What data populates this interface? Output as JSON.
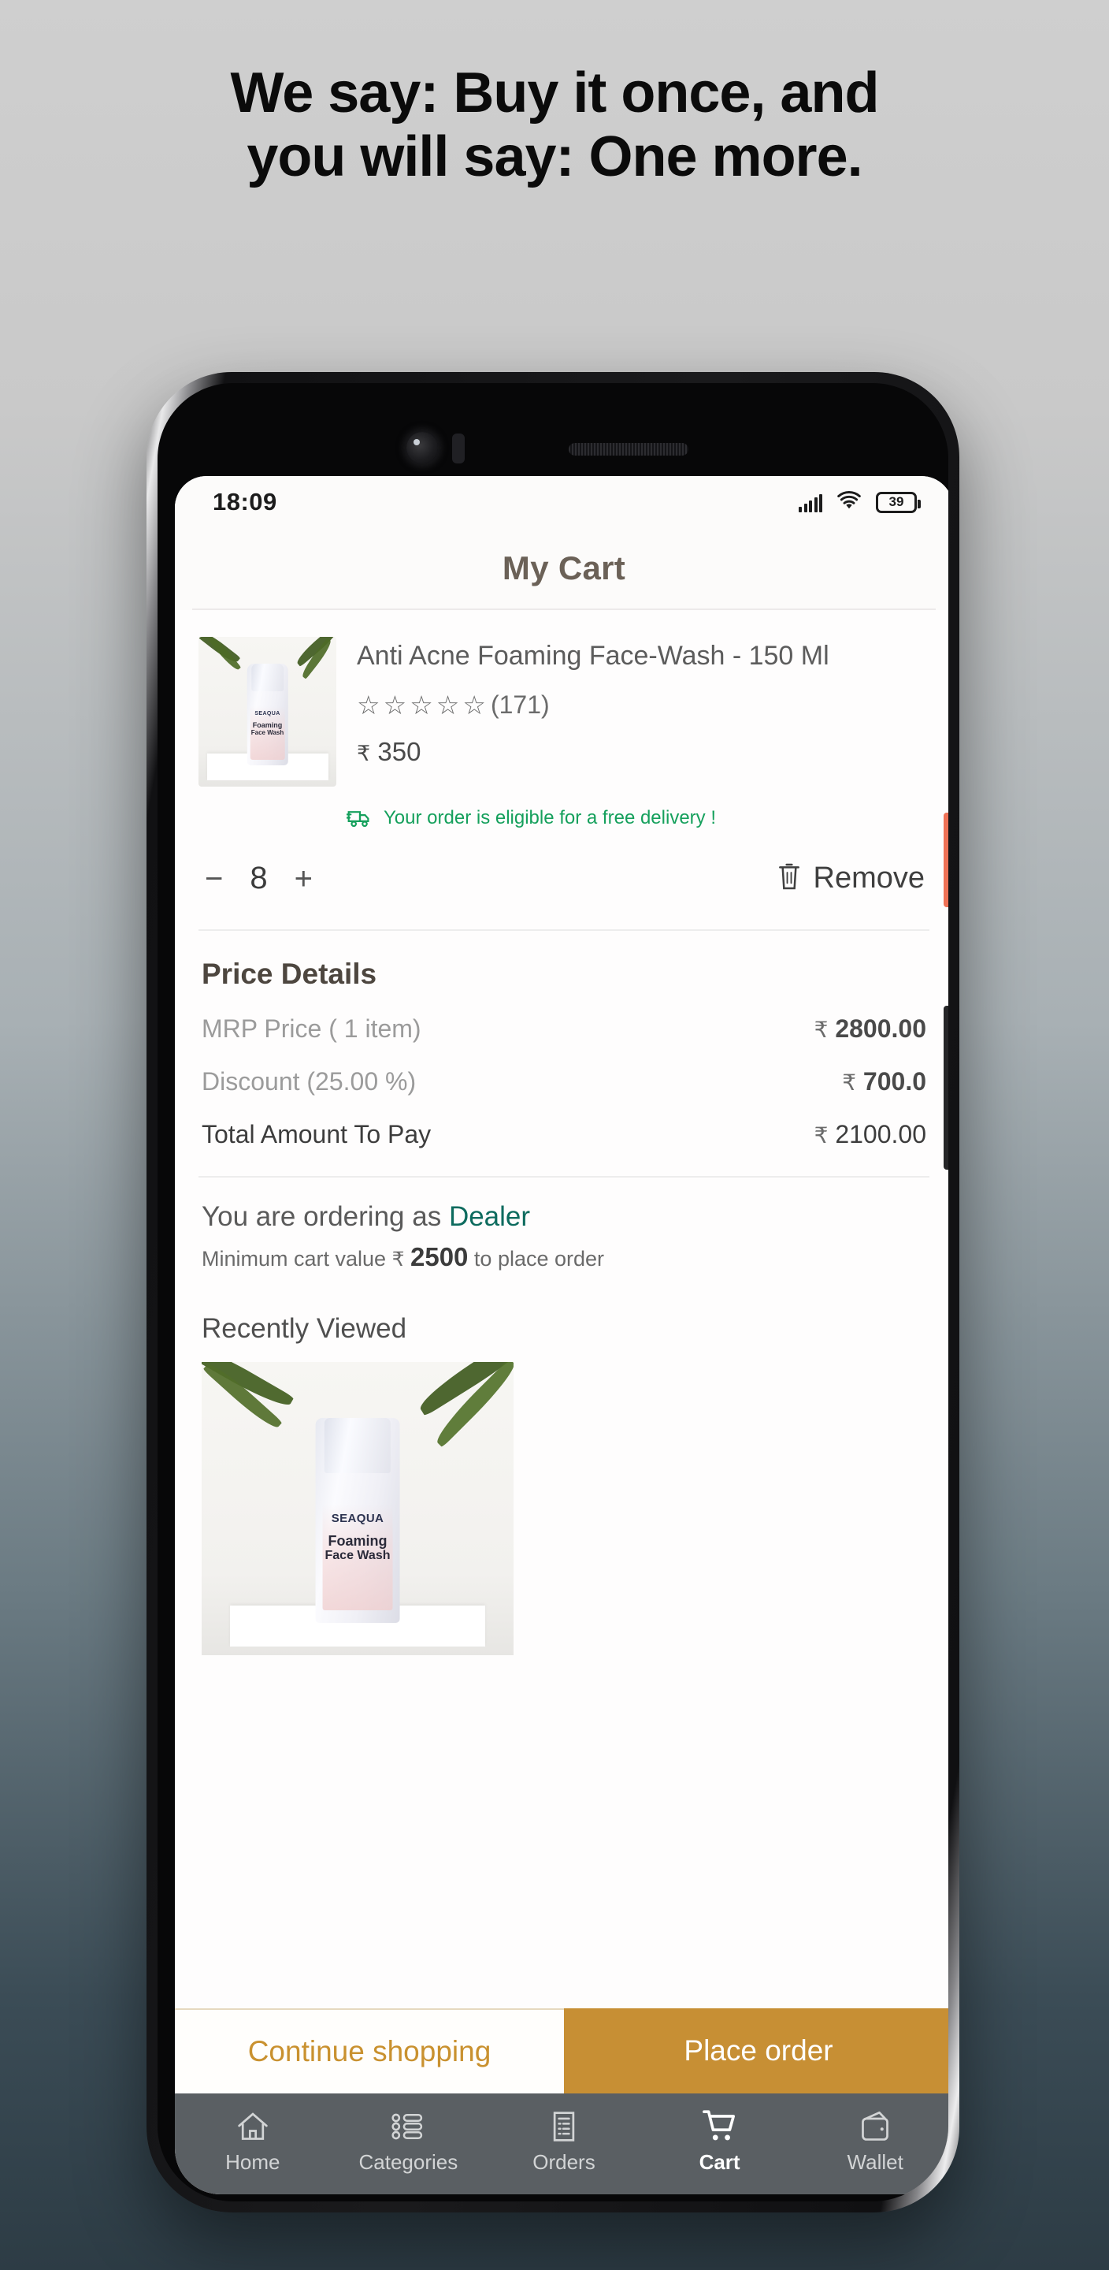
{
  "promo": {
    "line1": "We say: Buy it once, and",
    "line2": "you will say: One more."
  },
  "statusbar": {
    "time": "18:09",
    "signal_icon": "signal-bars-icon",
    "wifi_icon": "wifi-icon",
    "battery_level": "39"
  },
  "header": {
    "title": "My Cart"
  },
  "cart_item": {
    "image_alt": "anti-acne-foaming-face-wash-thumbnail",
    "brand": "SEAQUA",
    "label_line1": "Foaming",
    "label_line2": "Face Wash",
    "name": "Anti Acne Foaming Face-Wash - 150 Ml",
    "stars": [
      "☆",
      "☆",
      "☆",
      "☆",
      "☆"
    ],
    "rating_count": "(171)",
    "rupee": "₹",
    "price": "350",
    "delivery_message": "Your order is eligible for a free delivery !",
    "quantity": "8",
    "decrement_label": "−",
    "increment_label": "+",
    "remove_label": "Remove"
  },
  "price_details": {
    "title": "Price Details",
    "rows": [
      {
        "label": "MRP Price  ( 1 item)",
        "rupee": "₹",
        "value": "2800.00"
      },
      {
        "label": "Discount (25.00 %)",
        "rupee": "₹",
        "value": "700.0"
      },
      {
        "label": "Total Amount To Pay",
        "rupee": "₹",
        "value": "2100.00"
      }
    ]
  },
  "dealer": {
    "prefix": "You are ordering as ",
    "role": "Dealer",
    "min_prefix": "Minimum cart value ",
    "min_rupee": "₹",
    "min_value": "2500",
    "min_suffix": " to place order"
  },
  "recently_viewed": {
    "title": "Recently Viewed",
    "image_alt": "recently-viewed-face-wash-image",
    "brand": "SEAQUA",
    "label_line1": "Foaming",
    "label_line2": "Face Wash"
  },
  "actions": {
    "continue_label": "Continue shopping",
    "place_order_label": "Place order"
  },
  "bottom_nav": {
    "items": [
      {
        "label": "Home",
        "icon": "home-icon",
        "active": false
      },
      {
        "label": "Categories",
        "icon": "categories-list-icon",
        "active": false
      },
      {
        "label": "Orders",
        "icon": "orders-document-icon",
        "active": false
      },
      {
        "label": "Cart",
        "icon": "shopping-cart-icon",
        "active": true
      },
      {
        "label": "Wallet",
        "icon": "wallet-icon",
        "active": false
      }
    ]
  },
  "colors": {
    "accent_gold": "#c78f34",
    "delivery_green": "#15a05c",
    "dealer_teal": "#0d6b5e",
    "title_brown": "#6b6157",
    "nav_bar": "#5a5f63",
    "power_button": "#ef7256"
  }
}
